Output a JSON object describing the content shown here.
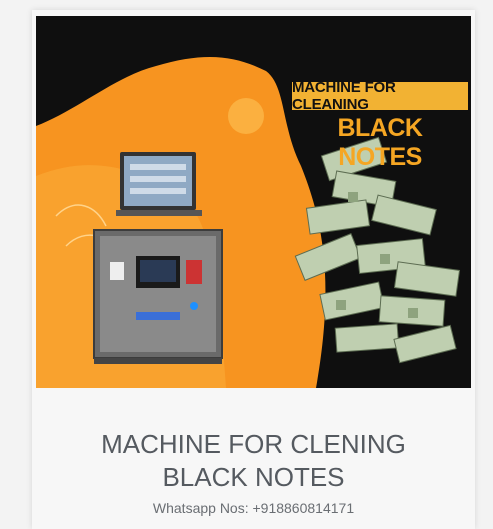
{
  "banner": {
    "headline_top": "MACHINE FOR CLEANING",
    "headline_bottom": "BLACK NOTES"
  },
  "caption": {
    "title_line1": "MACHINE FOR CLENING",
    "title_line2": "BLACK NOTES",
    "contact": "Whatsapp Nos: +918860814171"
  },
  "colors": {
    "accent_orange": "#f5a623",
    "background_dark": "#0f0f0f"
  }
}
